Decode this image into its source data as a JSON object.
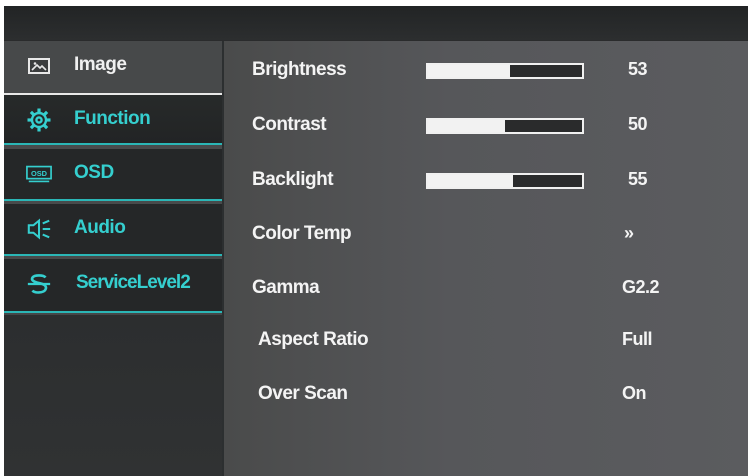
{
  "sidebar": {
    "items": [
      {
        "label": "Image",
        "icon": "image-icon"
      },
      {
        "label": "Function",
        "icon": "gear-icon",
        "selected": true
      },
      {
        "label": "OSD",
        "icon": "osd-icon"
      },
      {
        "label": "Audio",
        "icon": "speaker-icon"
      },
      {
        "label": "ServiceLevel2",
        "icon": "service-icon"
      }
    ]
  },
  "settings": [
    {
      "label": "Brightness",
      "value": "53",
      "level": 53
    },
    {
      "label": "Contrast",
      "value": "50",
      "level": 50
    },
    {
      "label": "Backlight",
      "value": "55",
      "level": 55
    },
    {
      "label": "Color Temp",
      "value": "»"
    },
    {
      "label": "Gamma",
      "value": "G2.2"
    },
    {
      "label": "Aspect Ratio",
      "value": "Full"
    },
    {
      "label": "Over Scan",
      "value": "On"
    }
  ],
  "colors": {
    "accent": "#35cfcf",
    "text": "#f4f4f4"
  }
}
